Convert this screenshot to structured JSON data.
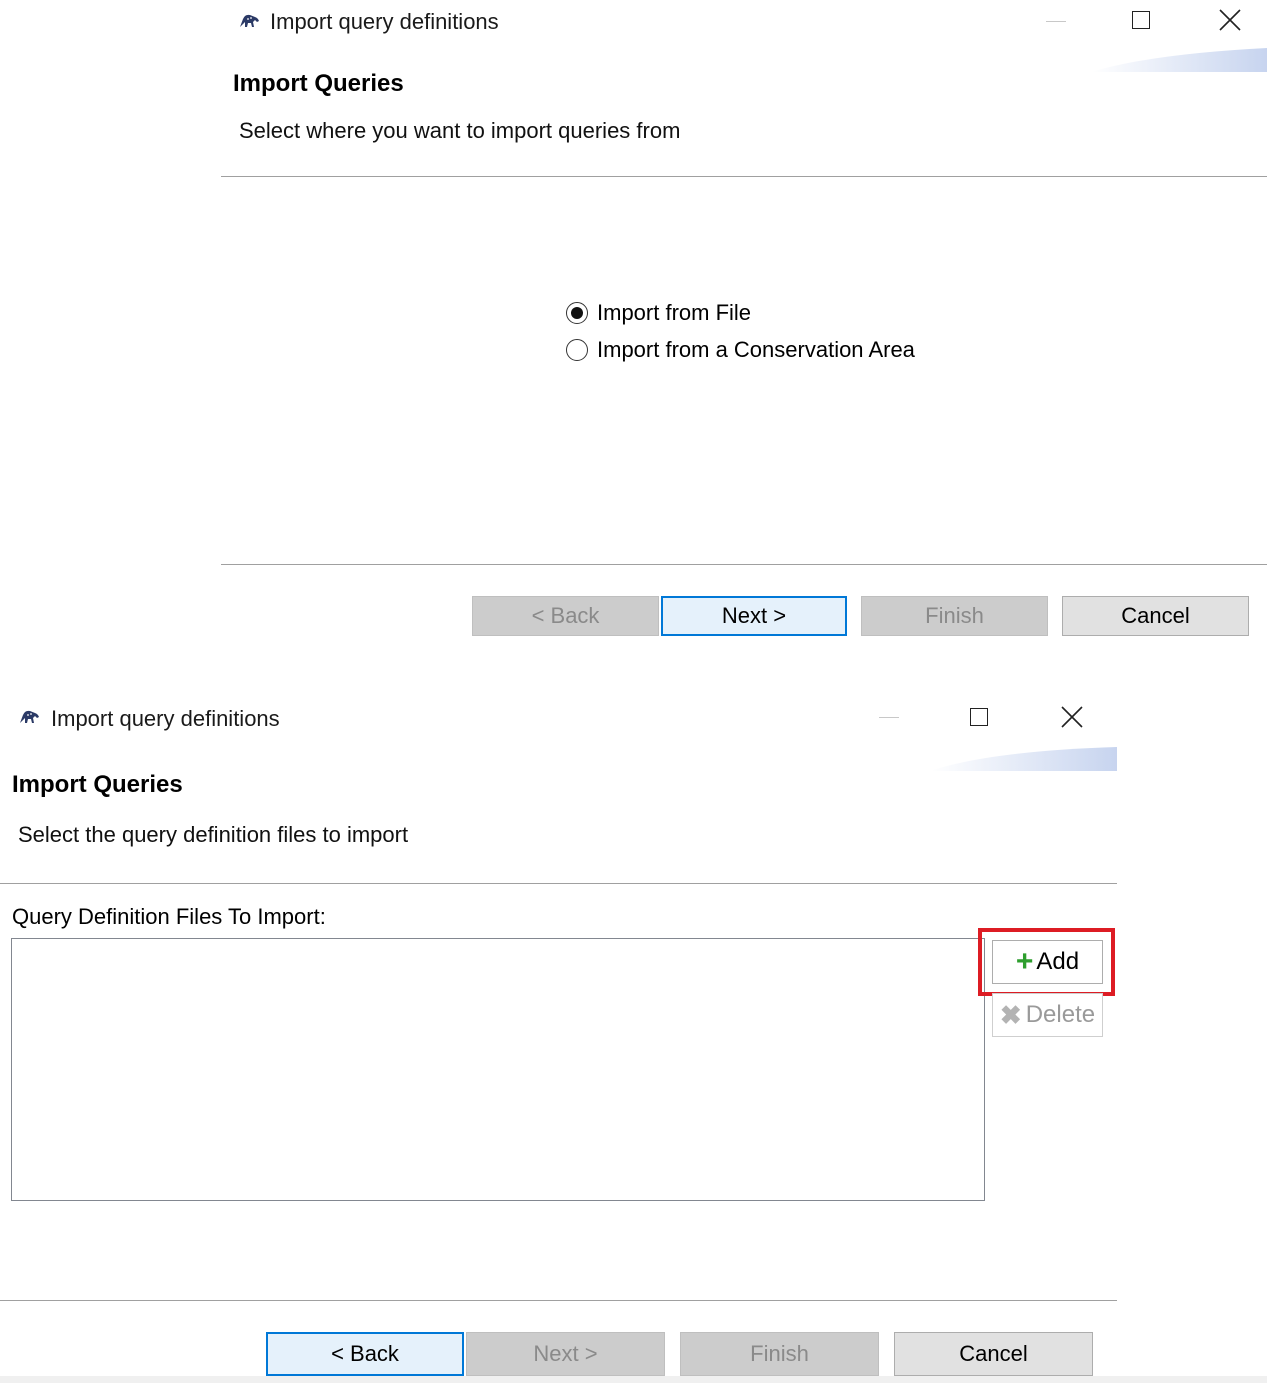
{
  "dialog1": {
    "title": "Import query definitions",
    "header_title": "Import Queries",
    "header_desc": "Select where you want to import queries from",
    "options": [
      {
        "label": "Import from File",
        "selected": true
      },
      {
        "label": "Import from a Conservation Area",
        "selected": false
      }
    ],
    "buttons": {
      "back": "< Back",
      "next": "Next >",
      "finish": "Finish",
      "cancel": "Cancel"
    }
  },
  "dialog2": {
    "title": "Import query definitions",
    "header_title": "Import Queries",
    "header_desc": "Select the query definition files to import",
    "list_label": "Query Definition Files To Import:",
    "add_label": "Add",
    "delete_label": "Delete",
    "buttons": {
      "back": "< Back",
      "next": "Next >",
      "finish": "Finish",
      "cancel": "Cancel"
    }
  },
  "colors": {
    "highlight": "#dd1c24",
    "default_button_border": "#0078d7",
    "add_icon": "#2e9e2e"
  },
  "icons": {
    "app": "leopard-icon",
    "minimize": "minimize-icon",
    "maximize": "maximize-icon",
    "close": "close-icon",
    "add": "plus-icon",
    "delete": "x-icon"
  }
}
